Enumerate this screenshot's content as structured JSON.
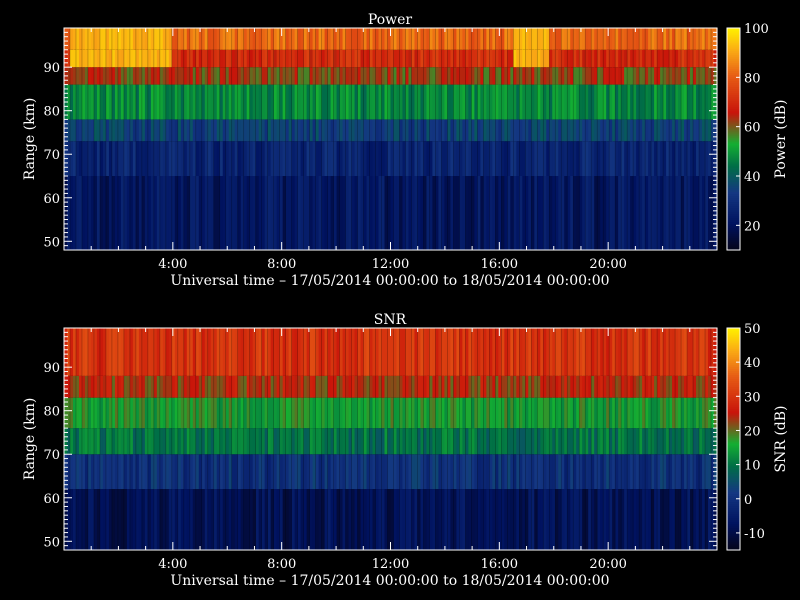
{
  "chart_data": [
    {
      "type": "heatmap",
      "title": "Power",
      "xlabel": "Universal time – 17/05/2014 00:00:00 to 18/05/2014 00:00:00",
      "ylabel": "Range (km)",
      "xlim": [
        0,
        24
      ],
      "ylim": [
        48,
        99
      ],
      "xticks": [
        "4:00",
        "8:00",
        "12:00",
        "16:00",
        "20:00"
      ],
      "yticks": [
        "50",
        "60",
        "70",
        "80",
        "90"
      ],
      "colorbar": {
        "label": "Power (dB)",
        "range": [
          10,
          100
        ],
        "ticks": [
          "20",
          "40",
          "60",
          "80",
          "100"
        ]
      },
      "grid": false,
      "bands": [
        {
          "range_min_km": 48,
          "range_max_km": 65,
          "value_db": 22
        },
        {
          "range_min_km": 65,
          "range_max_km": 73,
          "value_db": 27
        },
        {
          "range_min_km": 73,
          "range_max_km": 78,
          "value_db": 35
        },
        {
          "range_min_km": 78,
          "range_max_km": 86,
          "value_db": 48
        },
        {
          "range_min_km": 86,
          "range_max_km": 90,
          "value_db": 62
        },
        {
          "range_min_km": 90,
          "range_max_km": 94,
          "value_db": 70
        },
        {
          "range_min_km": 94,
          "range_max_km": 99,
          "value_db": 82
        }
      ],
      "hotspots": [
        {
          "time_start_h": 0.2,
          "time_end_h": 4.0,
          "range_min_km": 90,
          "value_db": 92
        },
        {
          "time_start_h": 16.5,
          "time_end_h": 17.8,
          "range_min_km": 88,
          "value_db": 92
        }
      ]
    },
    {
      "type": "heatmap",
      "title": "SNR",
      "xlabel": "Universal time – 17/05/2014 00:00:00 to 18/05/2014 00:00:00",
      "ylabel": "Range (km)",
      "xlim": [
        0,
        24
      ],
      "ylim": [
        48,
        99
      ],
      "xticks": [
        "4:00",
        "8:00",
        "12:00",
        "16:00",
        "20:00"
      ],
      "yticks": [
        "50",
        "60",
        "70",
        "80",
        "90"
      ],
      "colorbar": {
        "label": "SNR (dB)",
        "range": [
          -15,
          50
        ],
        "ticks": [
          "-10",
          "0",
          "10",
          "20",
          "30",
          "40",
          "50"
        ]
      },
      "grid": false,
      "bands": [
        {
          "range_min_km": 48,
          "range_max_km": 62,
          "value_db": -8
        },
        {
          "range_min_km": 62,
          "range_max_km": 70,
          "value_db": 0
        },
        {
          "range_min_km": 70,
          "range_max_km": 76,
          "value_db": 10
        },
        {
          "range_min_km": 76,
          "range_max_km": 83,
          "value_db": 16
        },
        {
          "range_min_km": 83,
          "range_max_km": 88,
          "value_db": 24
        },
        {
          "range_min_km": 88,
          "range_max_km": 99,
          "value_db": 30
        }
      ],
      "gaps": [
        {
          "time_start_h": 2.5,
          "time_end_h": 21.0,
          "range_min_km": 88,
          "range_max_km": 97
        }
      ]
    }
  ]
}
